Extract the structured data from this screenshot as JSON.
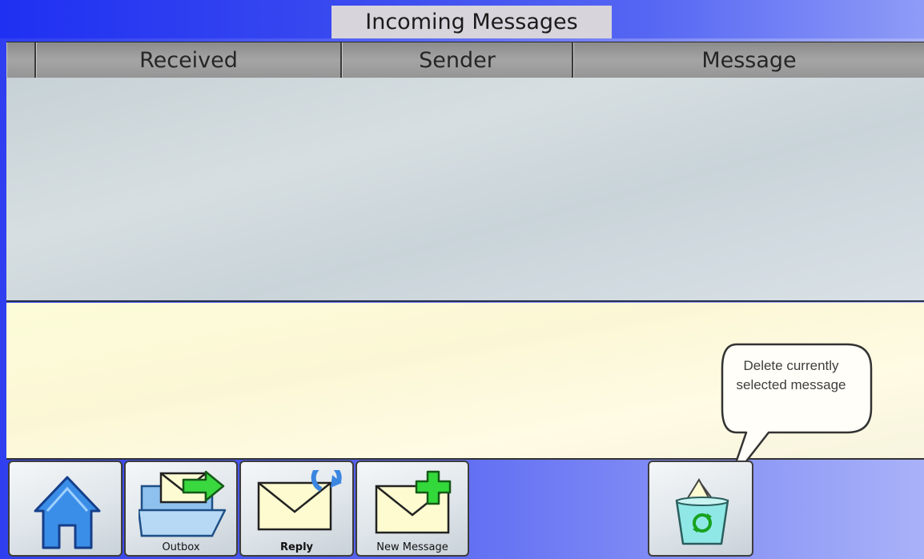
{
  "window": {
    "title": "Incoming Messages"
  },
  "table": {
    "columns": [
      "",
      "Received",
      "Sender",
      "Message"
    ],
    "rows": []
  },
  "toolbar": {
    "home": {
      "label": "",
      "icon": "home-icon"
    },
    "outbox": {
      "label": "Outbox",
      "icon": "outbox-folder-icon"
    },
    "reply": {
      "label": "Reply",
      "icon": "reply-envelope-icon"
    },
    "new_message": {
      "label": "New Message",
      "icon": "new-message-envelope-icon"
    },
    "delete": {
      "label": "",
      "icon": "recycle-bin-icon"
    }
  },
  "tooltip": {
    "text": "Delete currently selected message"
  },
  "colors": {
    "title_bar": "#3b4cf0",
    "list_bg": "#ccd6da",
    "preview_bg": "#fcf9d8",
    "accent_green": "#33d93a",
    "home_blue": "#3b8ee8"
  }
}
